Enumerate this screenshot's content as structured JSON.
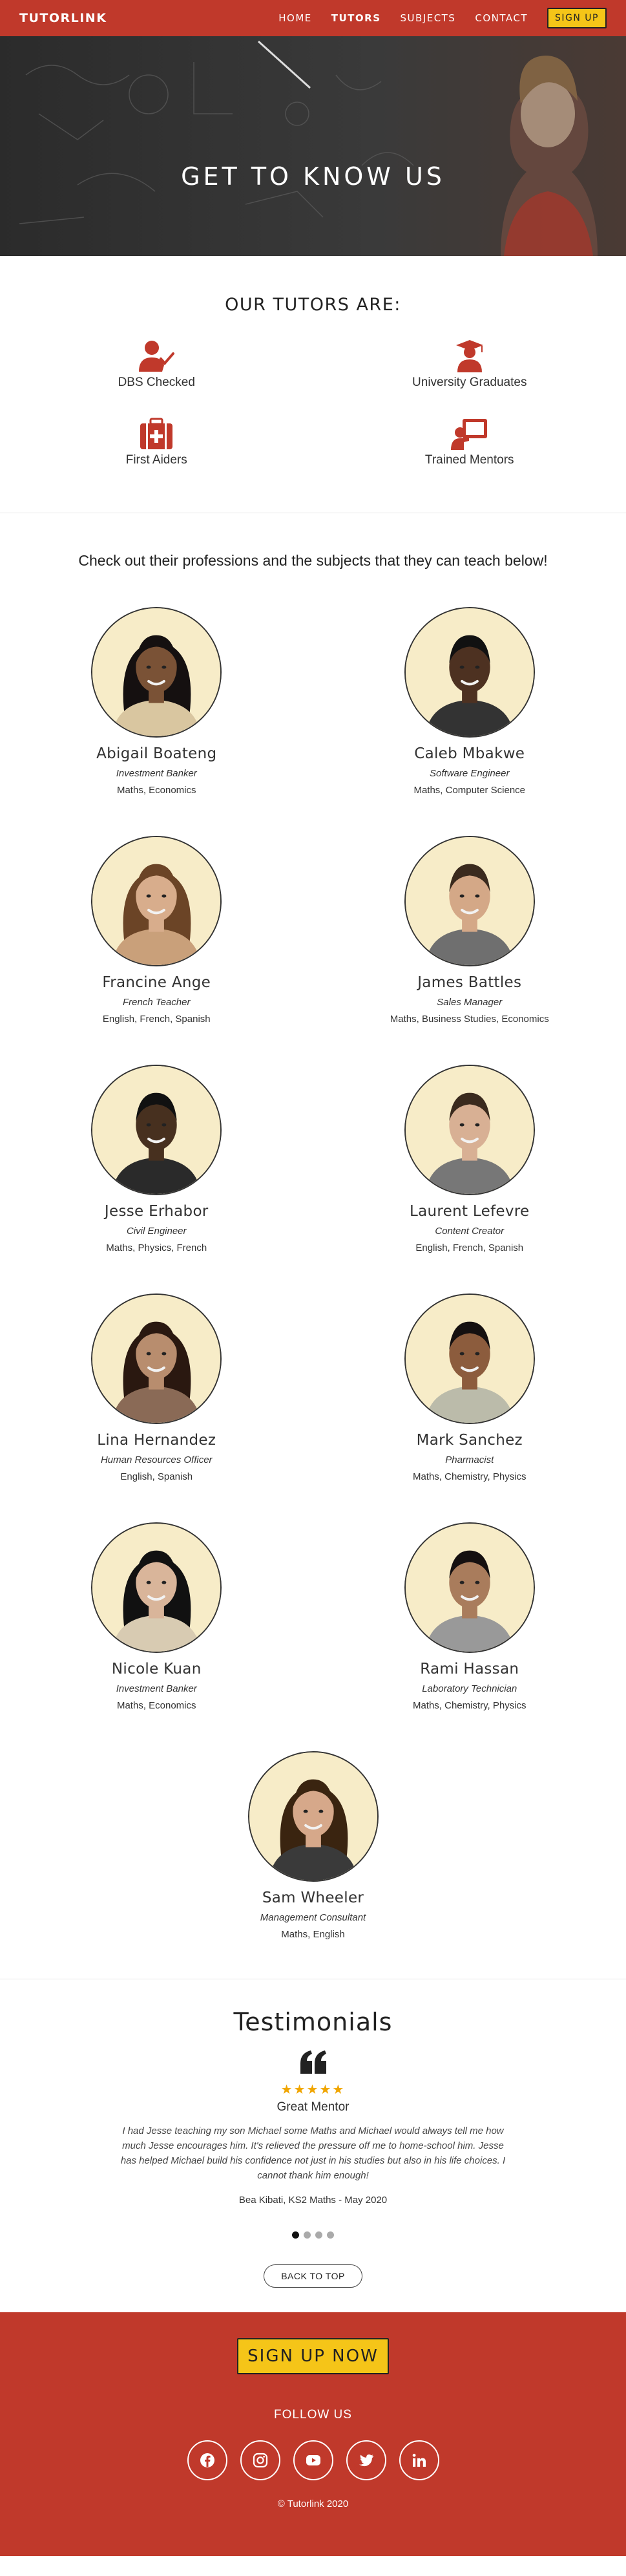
{
  "nav": {
    "brand": "TUTORLINK",
    "links": [
      "HOME",
      "TUTORS",
      "SUBJECTS",
      "CONTACT"
    ],
    "active": "TUTORS",
    "signup_label": "SIGN UP"
  },
  "hero": {
    "title": "GET TO KNOW US"
  },
  "features": {
    "title": "OUR TUTORS ARE:",
    "items": [
      {
        "label": "DBS Checked",
        "icon": "user-check-icon"
      },
      {
        "label": "University Graduates",
        "icon": "graduate-icon"
      },
      {
        "label": "First Aiders",
        "icon": "first-aid-kit-icon"
      },
      {
        "label": "Trained Mentors",
        "icon": "teacher-board-icon"
      }
    ]
  },
  "tutors": {
    "intro": "Check out their professions and the subjects that they can teach below!",
    "list": [
      {
        "name": "Abigail Boateng",
        "role": "Investment Banker",
        "subjects": "Maths, Economics"
      },
      {
        "name": "Caleb Mbakwe",
        "role": "Software Engineer",
        "subjects": "Maths, Computer Science"
      },
      {
        "name": "Francine Ange",
        "role": "French Teacher",
        "subjects": "English, French, Spanish"
      },
      {
        "name": "James Battles",
        "role": "Sales Manager",
        "subjects": "Maths, Business Studies, Economics"
      },
      {
        "name": "Jesse Erhabor",
        "role": "Civil Engineer",
        "subjects": "Maths, Physics, French"
      },
      {
        "name": "Laurent Lefevre",
        "role": "Content Creator",
        "subjects": "English, French, Spanish"
      },
      {
        "name": "Lina Hernandez",
        "role": "Human Resources Officer",
        "subjects": "English, Spanish"
      },
      {
        "name": "Mark Sanchez",
        "role": "Pharmacist",
        "subjects": "Maths, Chemistry, Physics"
      },
      {
        "name": "Nicole Kuan",
        "role": "Investment Banker",
        "subjects": "Maths, Economics"
      },
      {
        "name": "Rami Hassan",
        "role": "Laboratory Technician",
        "subjects": "Maths, Chemistry, Physics"
      },
      {
        "name": "Sam Wheeler",
        "role": "Management Consultant",
        "subjects": "Maths, English"
      }
    ]
  },
  "testimonials": {
    "title": "Testimonials",
    "rating": 5,
    "stars": "★★★★★",
    "heading": "Great Mentor",
    "text": "I had Jesse teaching my son Michael some Maths and Michael would always tell me how much Jesse encourages him. It's relieved the pressure off me to home-school him. Jesse has helped Michael build his confidence not just in his studies but also in his life choices. I cannot thank him enough!",
    "author": "Bea Kibati, KS2 Maths - May 2020",
    "slide_count": 4,
    "active_slide": 1,
    "back_to_top": "BACK TO TOP"
  },
  "footer": {
    "signup_label": "SIGN UP NOW",
    "follow_label": "FOLLOW US",
    "socials": [
      "facebook-icon",
      "instagram-icon",
      "youtube-icon",
      "twitter-icon",
      "linkedin-icon"
    ],
    "copyright": "© Tutorlink 2020"
  },
  "colors": {
    "brand_red": "#c0392b",
    "accent_yellow": "#f5c518",
    "star_orange": "#f0a500"
  }
}
